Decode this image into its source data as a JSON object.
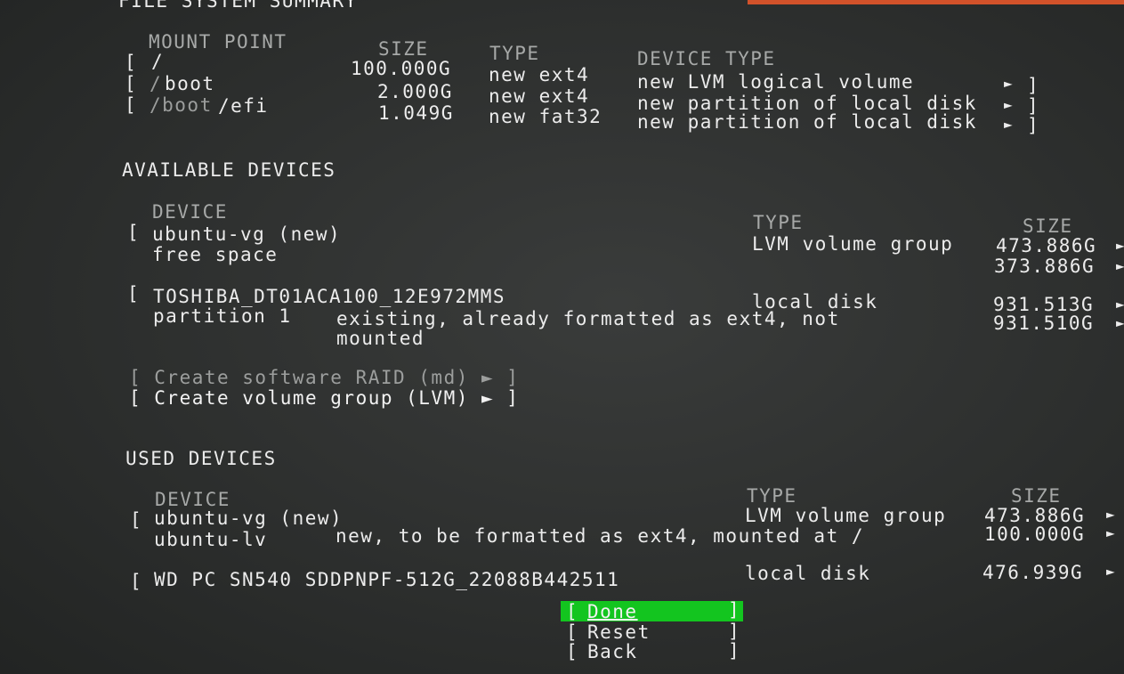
{
  "section_titles": {
    "file_system_summary": "FILE SYSTEM SUMMARY",
    "available_devices": "AVAILABLE DEVICES",
    "used_devices": "USED DEVICES"
  },
  "fs_summary": {
    "headers": {
      "mount_point": "MOUNT POINT",
      "size": "SIZE",
      "type": "TYPE",
      "device_type": "DEVICE TYPE"
    },
    "rows": [
      {
        "open": "[",
        "mount": "/",
        "size": "100.000G",
        "type": "new ext4",
        "device_type": "new LVM logical volume",
        "arrow": "►",
        "close": "]"
      },
      {
        "open": "[",
        "mount_prefix": "/",
        "mount": "boot",
        "size": "2.000G",
        "type": "new ext4",
        "device_type": "new partition of local disk",
        "arrow": "►",
        "close": "]"
      },
      {
        "open": "[",
        "mount_prefix": "/boot",
        "mount": "/efi",
        "size": "1.049G",
        "type": "new fat32",
        "device_type": "new partition of local disk",
        "arrow": "►",
        "close": "]"
      }
    ]
  },
  "available": {
    "headers": {
      "device": "DEVICE",
      "type": "TYPE",
      "size": "SIZE"
    },
    "vg": {
      "open": "[",
      "name": "ubuntu-vg (new)",
      "type": "LVM volume group",
      "size": "473.886G",
      "arrow": "►"
    },
    "free": {
      "name": "free space",
      "size": "373.886G",
      "arrow": "►"
    },
    "disk": {
      "open": "[",
      "name": "TOSHIBA_DT01ACA100_12E972MMS",
      "type": "local disk",
      "size": "931.513G",
      "arrow": "►"
    },
    "partition": {
      "name": "partition 1",
      "desc1": "existing, already formatted as ext4, not",
      "desc2": "mounted",
      "size": "931.510G",
      "arrow": "►"
    },
    "raid": "[ Create software RAID (md) ► ]",
    "lvm": "[ Create volume group (LVM) ► ]"
  },
  "used": {
    "headers": {
      "device": "DEVICE",
      "type": "TYPE",
      "size": "SIZE"
    },
    "vg": {
      "open": "[",
      "name": "ubuntu-vg (new)",
      "type": "LVM volume group",
      "size": "473.886G",
      "arrow": "►"
    },
    "lv": {
      "name": "ubuntu-lv",
      "desc": "new, to be formatted as ext4, mounted at /",
      "size": "100.000G",
      "arrow": "►"
    },
    "disk": {
      "open": "[",
      "name": "WD PC SN540 SDDPNPF-512G_22088B442511",
      "type": "local disk",
      "size": "476.939G",
      "arrow": "►"
    }
  },
  "buttons": {
    "done": {
      "open": "[",
      "label": "Done",
      "close": "]"
    },
    "reset": {
      "open": "[",
      "label": "Reset",
      "close": "]"
    },
    "back": {
      "open": "[",
      "label": "Back",
      "close": "]"
    }
  },
  "colors": {
    "background": "#2d2f2e",
    "selected": "#13c51f",
    "accent_stripe": "#d2522a"
  }
}
